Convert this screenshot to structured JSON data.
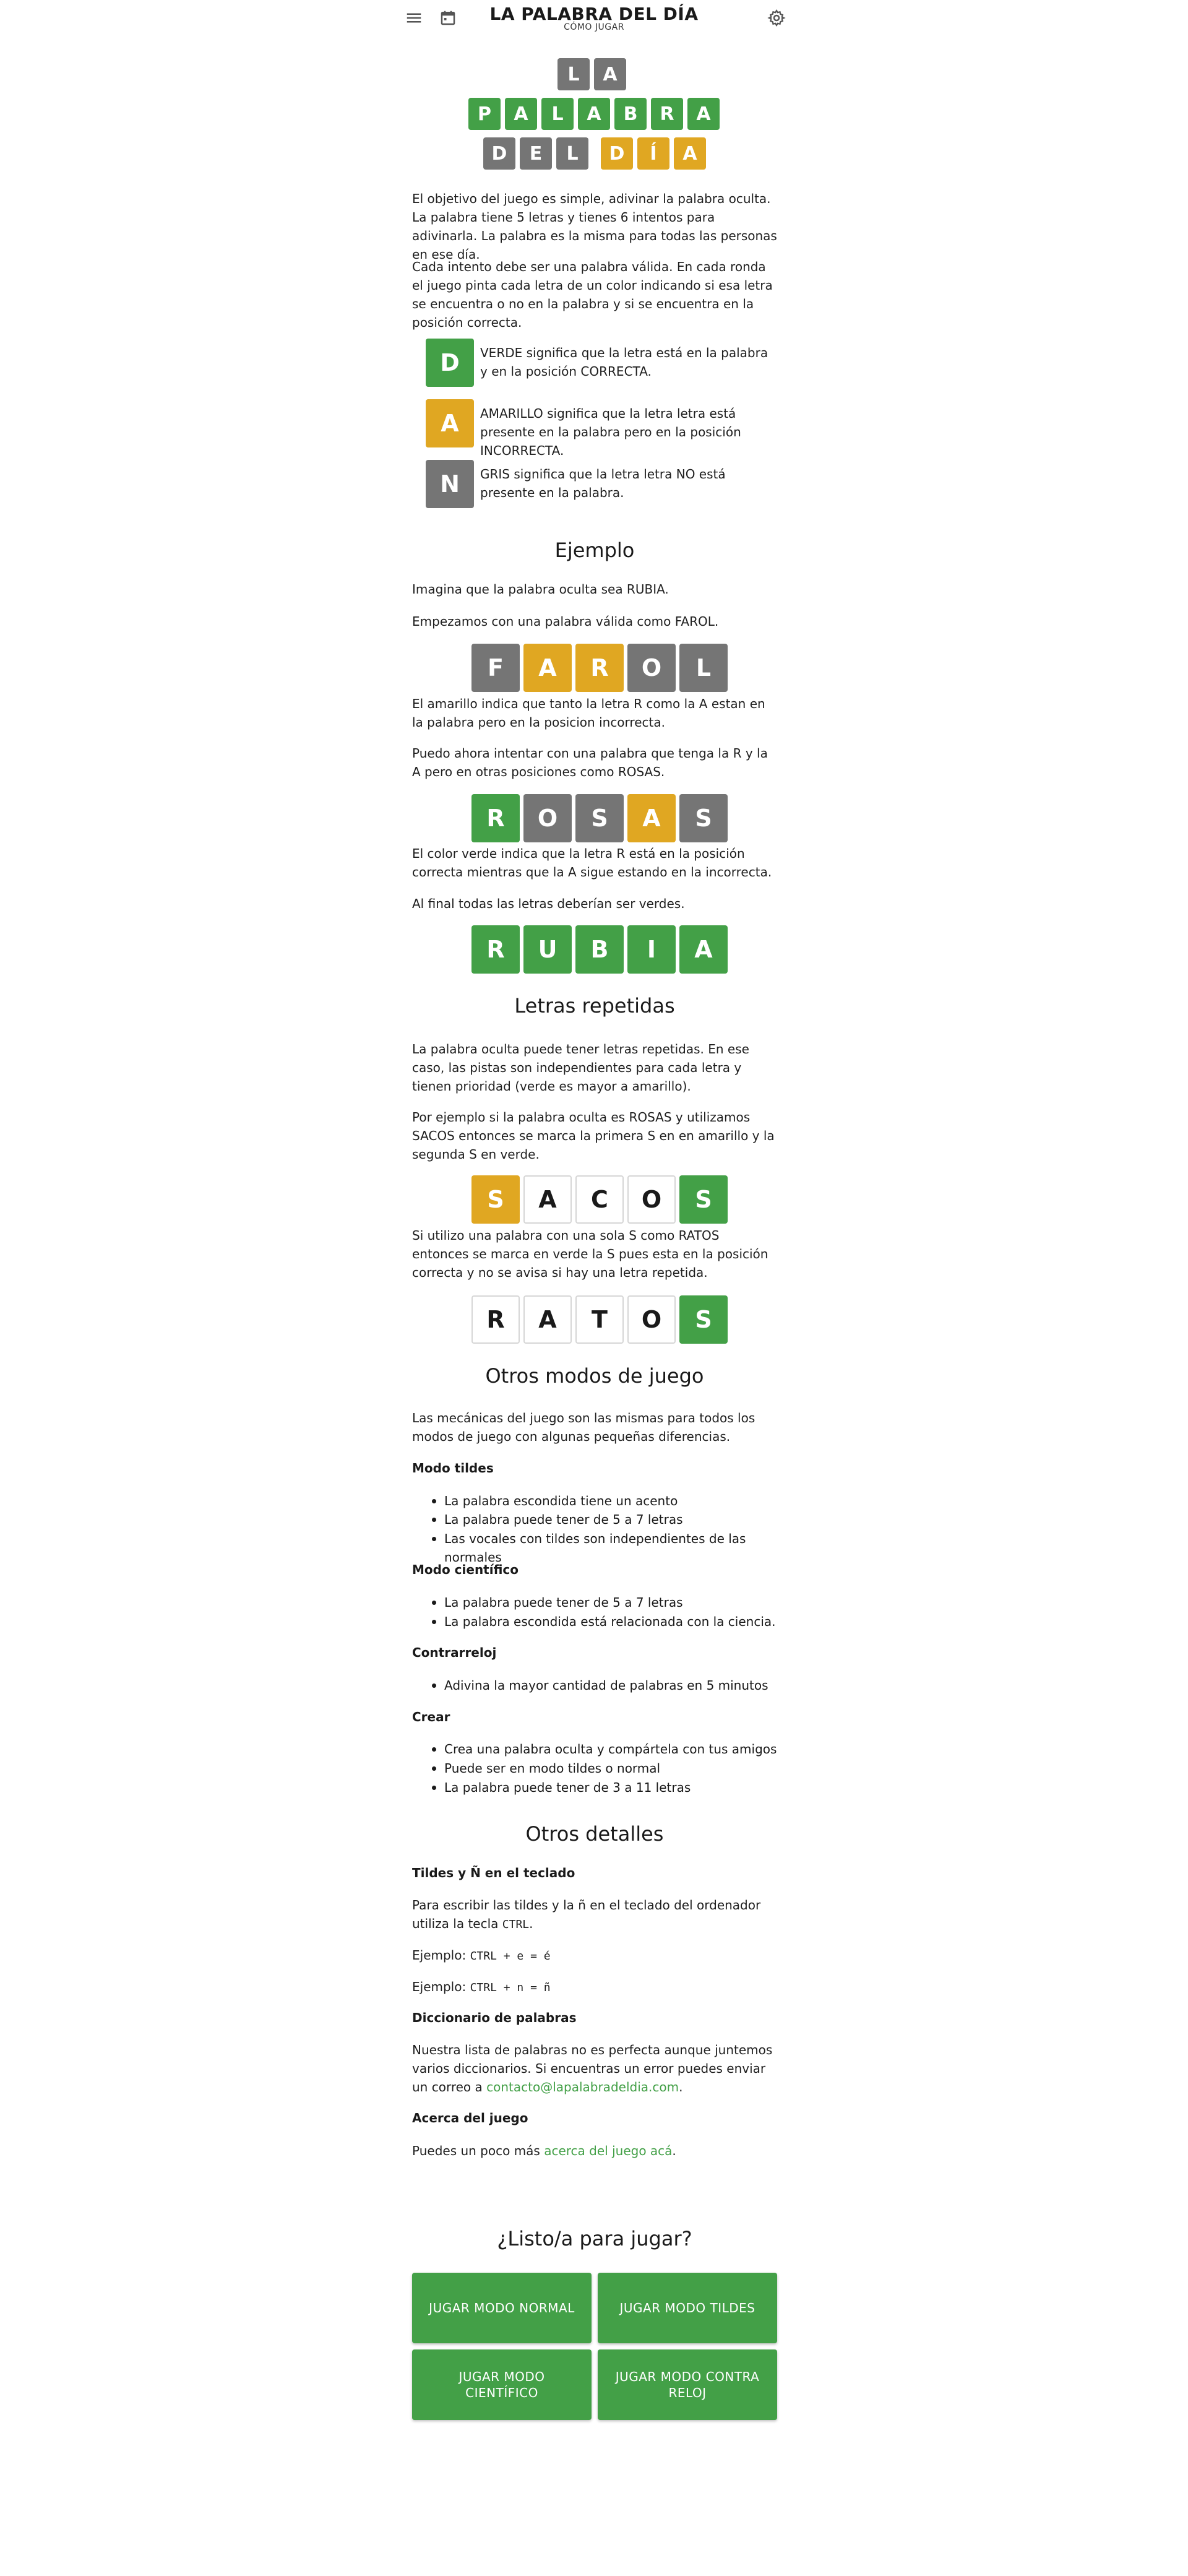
{
  "header": {
    "title": "LA PALABRA DEL DÍA",
    "subtitle": "CÓMO JUGAR",
    "icons": {
      "menu": "menu-icon",
      "calendar": "calendar-icon",
      "settings": "gear-icon"
    }
  },
  "colors": {
    "green": "#43a047",
    "yellow": "#e0a722",
    "gray": "#757575",
    "link": "#43a047"
  },
  "logo": {
    "row1": [
      "L",
      "A"
    ],
    "row2": [
      "P",
      "A",
      "L",
      "A",
      "B",
      "R",
      "A"
    ],
    "row3": [
      "D",
      "E",
      "L",
      "D",
      "Í",
      "A"
    ]
  },
  "intro": {
    "p1": "El objetivo del juego es simple, adivinar la palabra oculta. La palabra tiene 5 letras y tienes 6 intentos para adivinarla. La palabra es la misma para todas las personas en ese día.",
    "p2": "Cada intento debe ser una palabra válida. En cada ronda el juego pinta cada letra de un color indicando si esa letra se encuentra o no en la palabra y si se encuentra en la posición correcta."
  },
  "legend": [
    {
      "letter": "D",
      "color": "green",
      "text": "VERDE significa que la letra está en la palabra y en la posición CORRECTA."
    },
    {
      "letter": "A",
      "color": "yellow",
      "text": "AMARILLO significa que la letra letra está presente en la palabra pero en la posición INCORRECTA."
    },
    {
      "letter": "N",
      "color": "gray",
      "text": "GRIS significa que la letra letra NO está presente en la palabra."
    }
  ],
  "example": {
    "heading": "Ejemplo",
    "p1": "Imagina que la palabra oculta sea RUBIA.",
    "p2": "Empezamos con una palabra válida como FAROL.",
    "row1": [
      "F",
      "A",
      "R",
      "O",
      "L"
    ],
    "p3": "El amarillo indica que tanto la letra R como la A estan en la palabra pero en la posicion incorrecta.",
    "p4": "Puedo ahora intentar con una palabra que tenga la R y la A pero en otras posiciones como ROSAS.",
    "row2": [
      "R",
      "O",
      "S",
      "A",
      "S"
    ],
    "p5": "El color verde indica que la letra R está en la posición correcta mientras que la A sigue estando en la incorrecta.",
    "p6": "Al final todas las letras deberían ser verdes.",
    "row3": [
      "R",
      "U",
      "B",
      "I",
      "A"
    ]
  },
  "repeated": {
    "heading": "Letras repetidas",
    "p1": "La palabra oculta puede tener letras repetidas. En ese caso, las pistas son independientes para cada letra y tienen prioridad (verde es mayor a amarillo).",
    "p2": "Por ejemplo si la palabra oculta es ROSAS y utilizamos SACOS entonces se marca la primera S en en amarillo y la segunda S en verde.",
    "row1": [
      "S",
      "A",
      "C",
      "O",
      "S"
    ],
    "p3": "Si utilizo una palabra con una sola S como RATOS entonces se marca en verde la S pues esta en la posición correcta y no se avisa si hay una letra repetida.",
    "row2": [
      "R",
      "A",
      "T",
      "O",
      "S"
    ]
  },
  "modes": {
    "heading": "Otros modos de juego",
    "intro": "Las mecánicas del juego son las mismas para todos los modos de juego con algunas pequeñas diferencias.",
    "tildes": {
      "title": "Modo tildes",
      "items": [
        "La palabra escondida tiene un acento",
        "La palabra puede tener de 5 a 7 letras",
        "Las vocales con tildes son independientes de las normales"
      ]
    },
    "cientifico": {
      "title": "Modo científico",
      "items": [
        "La palabra puede tener de 5 a 7 letras",
        "La palabra escondida está relacionada con la ciencia."
      ]
    },
    "contrarreloj": {
      "title": "Contrarreloj",
      "items": [
        "Adivina la mayor cantidad de palabras en 5 minutos"
      ]
    },
    "crear": {
      "title": "Crear",
      "items": [
        "Crea una palabra oculta y compártela con tus amigos",
        "Puede ser en modo tildes o normal",
        "La palabra puede tener de 3 a 11 letras"
      ]
    }
  },
  "details": {
    "heading": "Otros detalles",
    "keyboard_title": "Tildes y Ñ en el teclado",
    "keyboard_p1": "Para escribir las tildes y la ñ en el teclado del ordenador utiliza la tecla",
    "keyboard_ctrl": "CTRL",
    "ex1_label": "Ejemplo:",
    "ex1_keys": "CTRL + e = é",
    "ex2_label": "Ejemplo:",
    "ex2_keys": "CTRL + n = ñ",
    "dict_title": "Diccionario de palabras",
    "dict_p": "Nuestra lista de palabras no es perfecta aunque juntemos varios diccionarios. Si encuentras un error puedes enviar un correo a",
    "dict_email": "contacto@lapalabradeldia.com",
    "about_title": "Acerca del juego",
    "about_p": "Puedes un poco más",
    "about_link": "acerca del juego acá"
  },
  "cta": {
    "heading": "¿Listo/a para jugar?",
    "buttons": [
      "JUGAR MODO NORMAL",
      "JUGAR MODO TILDES",
      "JUGAR MODO CIENTÍFICO",
      "JUGAR MODO CONTRA RELOJ"
    ]
  }
}
